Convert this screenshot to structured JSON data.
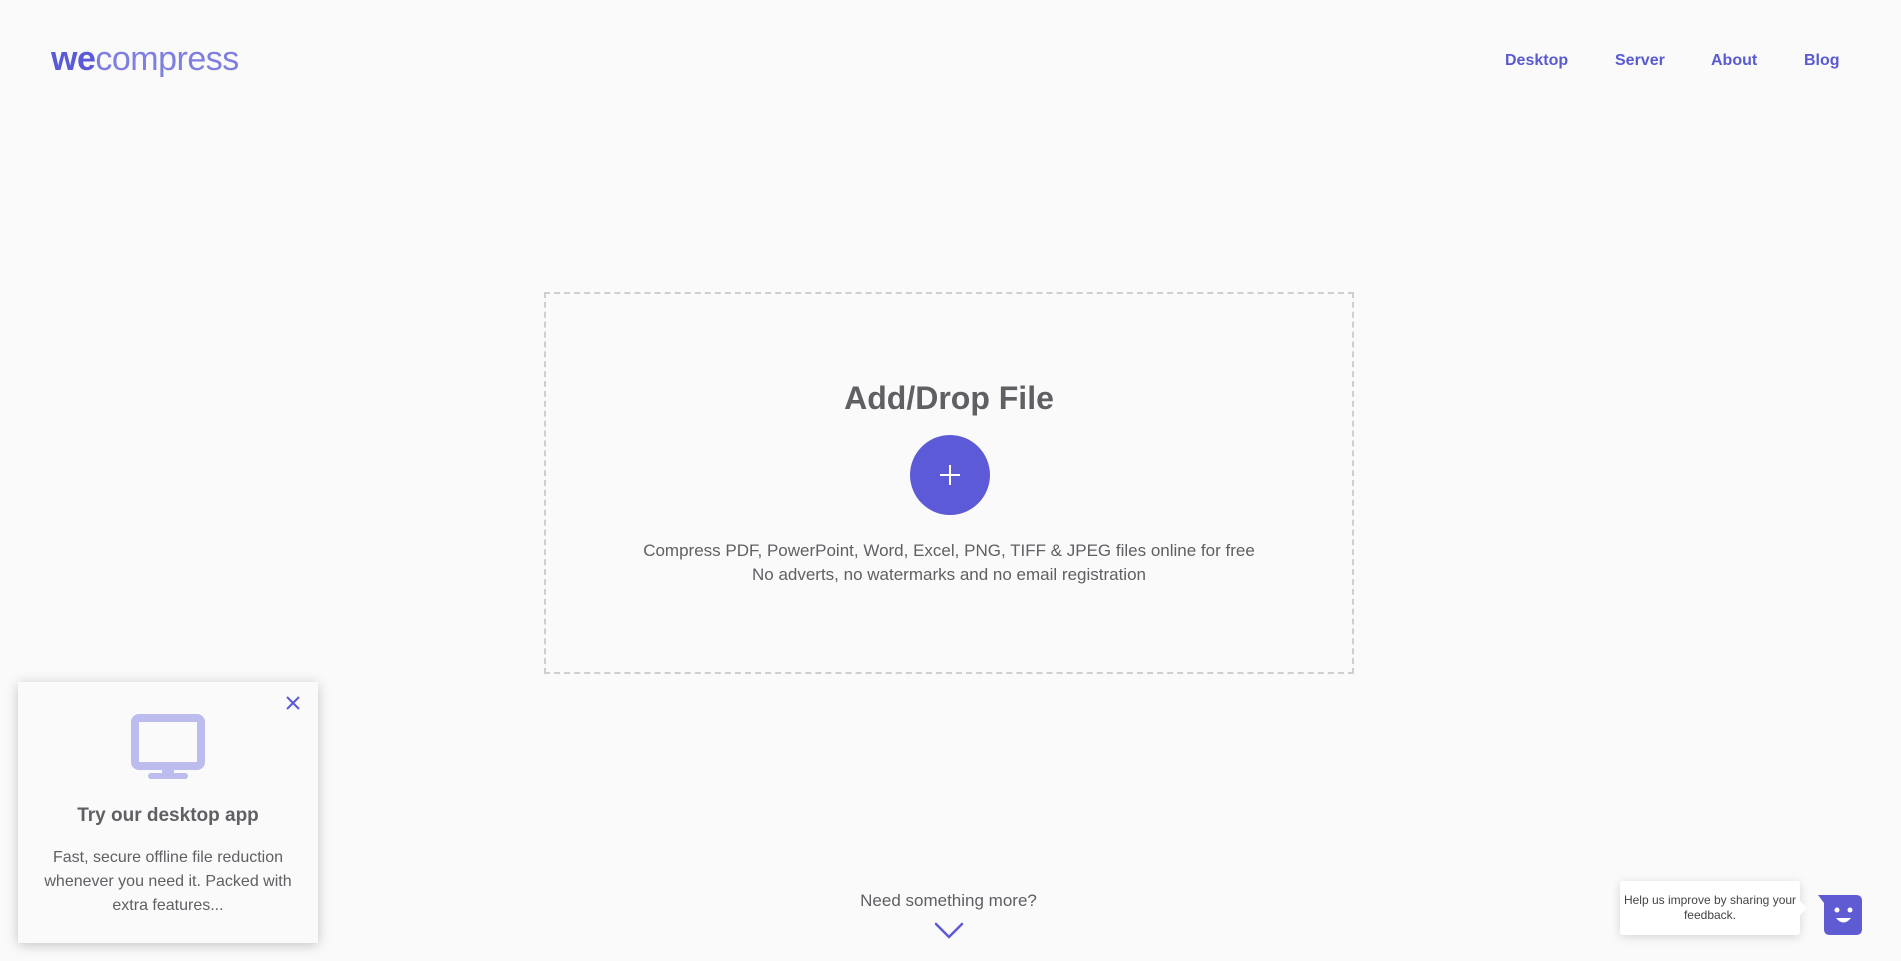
{
  "header": {
    "logo": {
      "part1": "we",
      "part2": "compress"
    },
    "nav": [
      {
        "label": "Desktop"
      },
      {
        "label": "Server"
      },
      {
        "label": "About"
      },
      {
        "label": "Blog"
      }
    ]
  },
  "dropzone": {
    "title": "Add/Drop File",
    "add_icon": "plus-icon",
    "line1": "Compress PDF, PowerPoint, Word, Excel, PNG, TIFF & JPEG files online for free",
    "line2": "No adverts, no watermarks and no email registration"
  },
  "more": {
    "label": "Need something more?",
    "icon": "chevron-down-icon"
  },
  "promo": {
    "icon": "monitor-icon",
    "close_icon": "close-icon",
    "title": "Try our desktop app",
    "body": "Fast, secure offline file reduction whenever you need it. Packed with extra features..."
  },
  "feedback": {
    "tooltip": "Help us improve by sharing your feedback.",
    "icon": "smiley-chat-icon"
  },
  "colors": {
    "accent": "#5c5ad6",
    "accent_light": "#bcbcee",
    "text": "#5f5f64",
    "background": "#fafafa",
    "dashed_border": "#cfcfcf"
  }
}
